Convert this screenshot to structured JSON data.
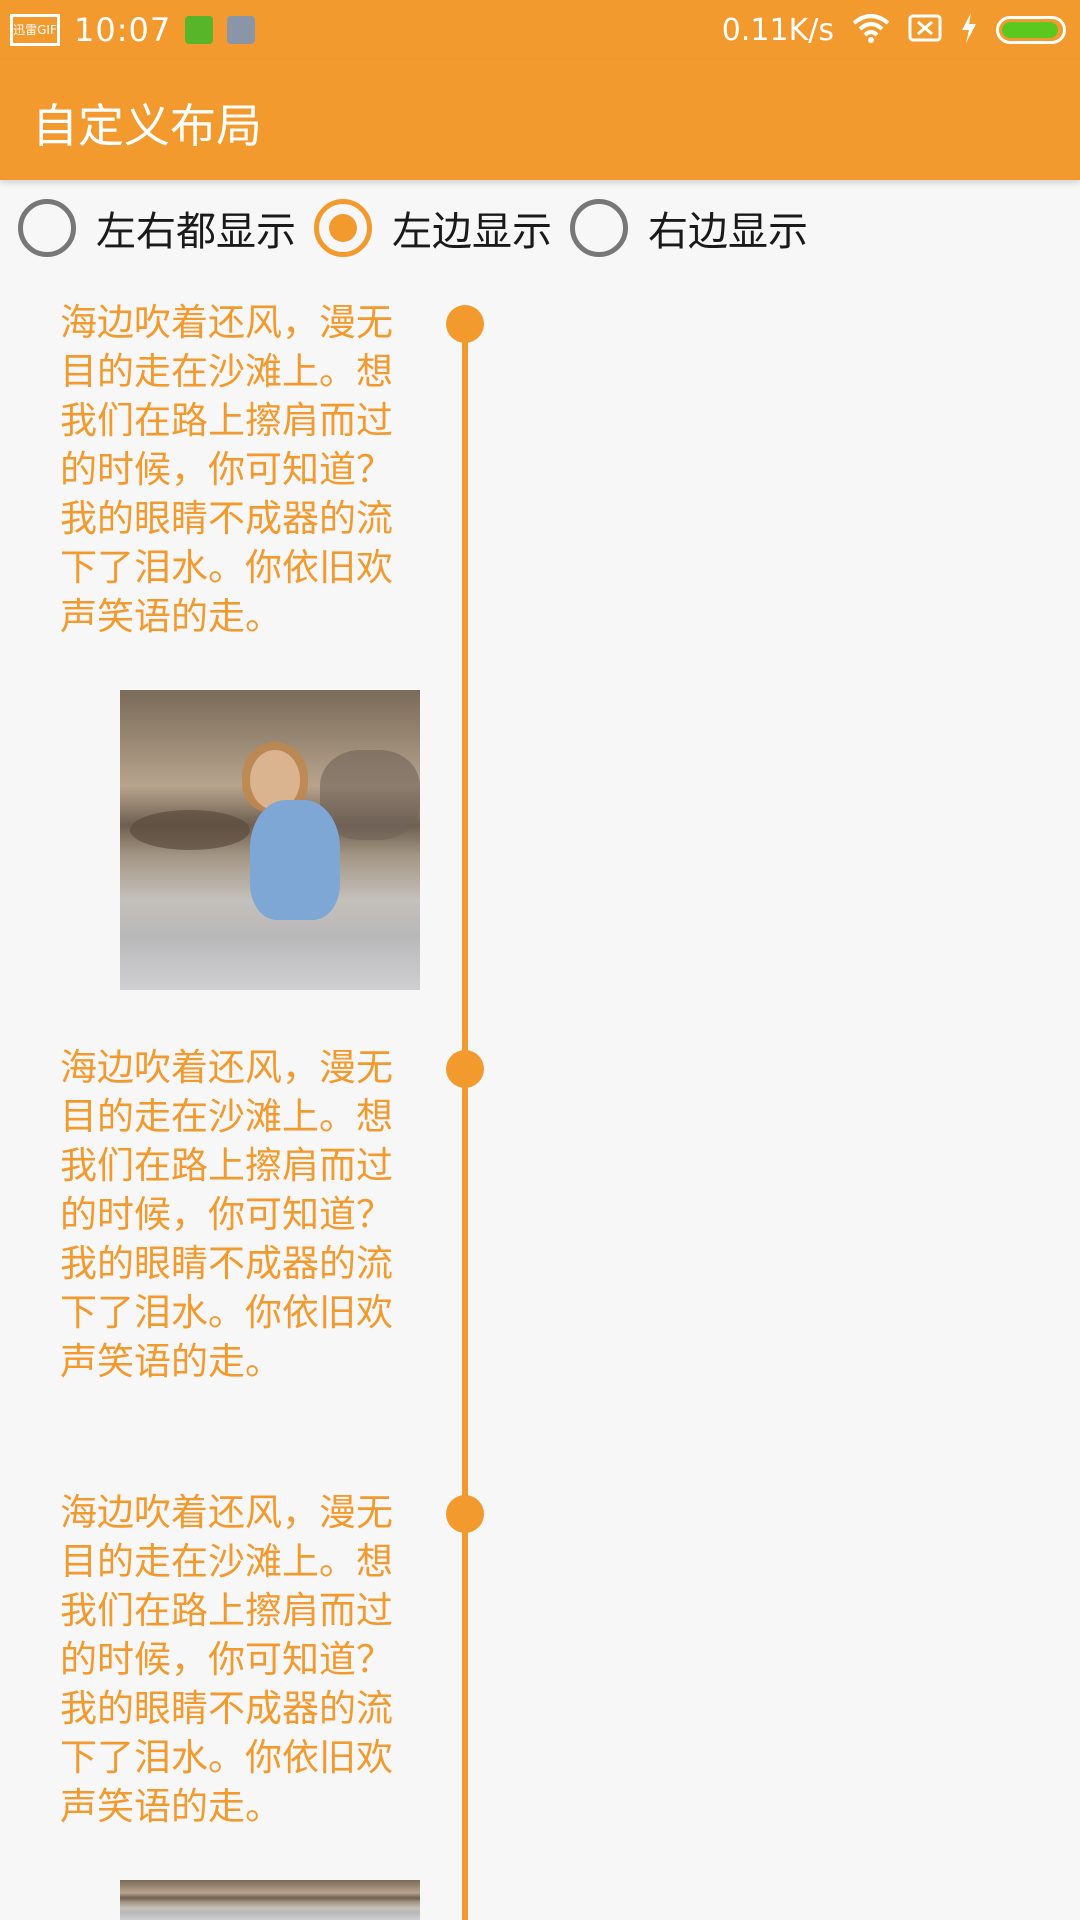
{
  "status_bar": {
    "rec_label": "迅雷GIF",
    "time": "10:07",
    "net_speed": "0.11K/s"
  },
  "toolbar": {
    "title": "自定义布局"
  },
  "radio_options": [
    {
      "label": "左右都显示",
      "checked": false
    },
    {
      "label": "左边显示",
      "checked": true
    },
    {
      "label": "右边显示",
      "checked": false
    }
  ],
  "timeline": {
    "entries": [
      {
        "text": "海边吹着还风，漫无目的走在沙滩上。想我们在路上擦肩而过的时候，你可知道？我的眼睛不成器的流下了泪水。你依旧欢声笑语的走。",
        "has_image": true
      },
      {
        "text": "海边吹着还风，漫无目的走在沙滩上。想我们在路上擦肩而过的时候，你可知道？我的眼睛不成器的流下了泪水。你依旧欢声笑语的走。",
        "has_image": false
      },
      {
        "text": "海边吹着还风，漫无目的走在沙滩上。想我们在路上擦肩而过的时候，你可知道？我的眼睛不成器的流下了泪水。你依旧欢声笑语的走。",
        "has_image": true
      }
    ]
  },
  "colors": {
    "accent": "#f39a2e",
    "background": "#f7f7f7",
    "radio_unchecked": "#777777",
    "battery": "#5ac81e"
  },
  "icons": {
    "status": [
      "screen-record-icon",
      "android-app-icon",
      "notification-icon",
      "wifi-icon",
      "sim-off-icon",
      "charging-icon",
      "battery-icon"
    ]
  }
}
